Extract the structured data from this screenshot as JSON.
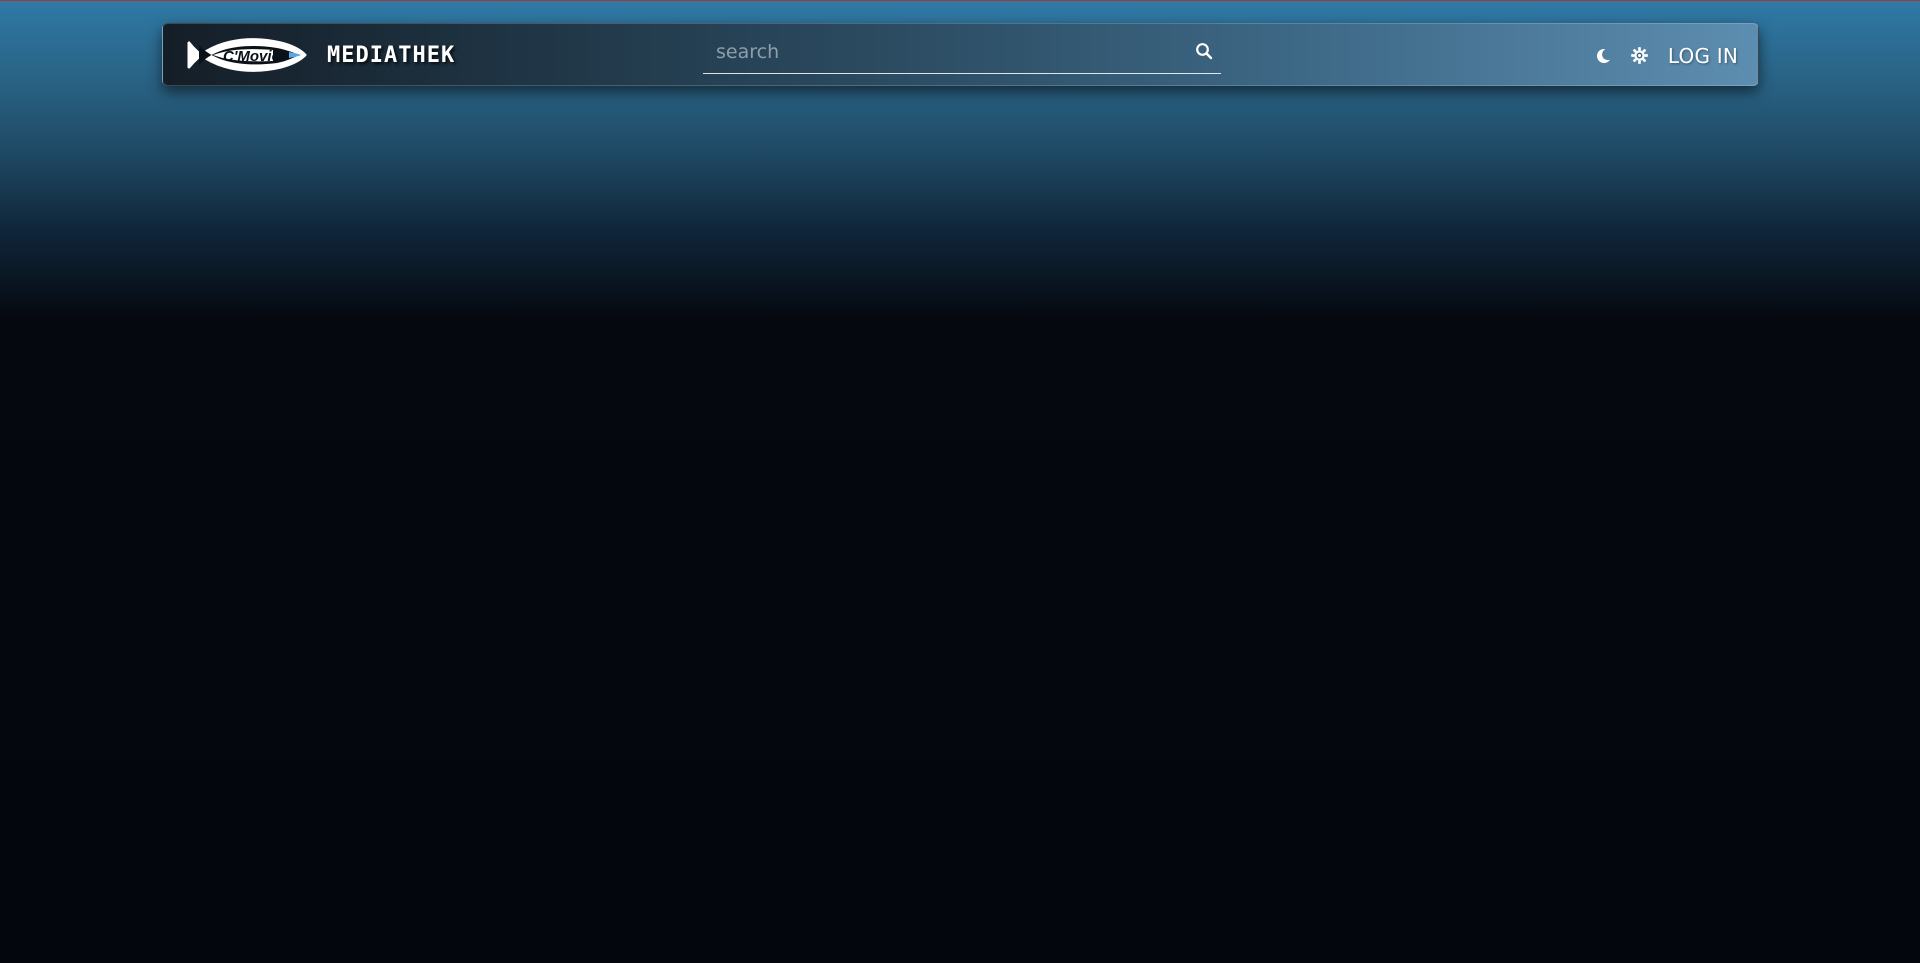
{
  "header": {
    "logo_text": "C'Movie",
    "brand_title": "MEDIATHEK",
    "search": {
      "placeholder": "search",
      "value": ""
    },
    "icons": {
      "search": "search-icon",
      "theme": "moon-icon",
      "settings": "gear-icon"
    },
    "login_label": "LOG IN"
  },
  "colors": {
    "page_top": "#2f7aa6",
    "page_bottom": "#03060d",
    "navbar_left": "#141e27",
    "navbar_right": "#5d8db0",
    "text": "#ffffff"
  }
}
